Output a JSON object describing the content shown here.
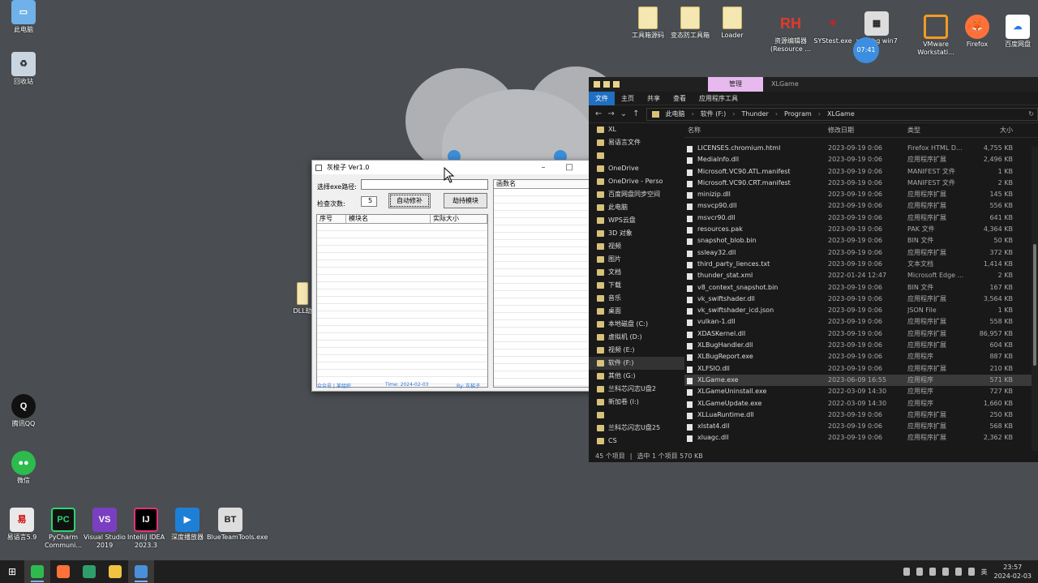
{
  "desktop": {
    "icons_left": [
      {
        "label": "此电脑",
        "name": "this-pc"
      },
      {
        "label": "回收站",
        "name": "recycle-bin"
      },
      {
        "label": "腾讯QQ",
        "name": "qq"
      },
      {
        "label": "微信",
        "name": "wechat"
      }
    ],
    "icons_bottom": [
      {
        "label": "易语言5.9",
        "name": "eyuyan"
      },
      {
        "label": "PyCharm Communi...",
        "name": "pycharm"
      },
      {
        "label": "Visual Studio 2019",
        "name": "visual-studio"
      },
      {
        "label": "IntelliJ IDEA 2023.3",
        "name": "intellij"
      },
      {
        "label": "深度播放器",
        "name": "player"
      },
      {
        "label": "BlueTeamTools.exe",
        "name": "blueteamtools"
      }
    ],
    "icons_top": [
      {
        "label": "工具箱源码",
        "name": "folder-toolbox-src"
      },
      {
        "label": "变态防工具箱",
        "name": "folder-toolbox"
      },
      {
        "label": "Loader",
        "name": "folder-loader"
      },
      {
        "label": "资源编辑器 (Resource ...",
        "name": "resource-hacker"
      },
      {
        "label": "SYStest.exe",
        "name": "systest"
      },
      {
        "label": "x64dbg win7",
        "name": "x64dbg"
      },
      {
        "label": "VMware Workstati...",
        "name": "vmware"
      },
      {
        "label": "Firefox",
        "name": "firefox"
      },
      {
        "label": "百度网盘",
        "name": "baidu-netdisk"
      }
    ],
    "partial_label": "DLL劫",
    "clock_badge": "07:41"
  },
  "app": {
    "title": "灰梭子 Ver1.0",
    "path_label": "选择exe路径:",
    "path_value": "",
    "check_label": "检查次数:",
    "check_value": "5",
    "auto_button": "自动修补",
    "hijack_button": "劫持模块",
    "left_columns": [
      "序号",
      "模块名",
      "实际大小"
    ],
    "right_columns": [
      "函数名"
    ],
    "footer": {
      "left": "众众号 | 某组织",
      "mid": "Time: 2024-02-03",
      "right": "By: 灰梭子"
    }
  },
  "explorer": {
    "manage_tab": "管理",
    "window_title": "XLGame",
    "ribbon_tabs": [
      "文件",
      "主页",
      "共享",
      "查看",
      "应用程序工具"
    ],
    "breadcrumbs": [
      "此电脑",
      "软件 (F:)",
      "Thunder",
      "Program",
      "XLGame"
    ],
    "columns": [
      "名称",
      "修改日期",
      "类型",
      "大小"
    ],
    "nav_items": [
      {
        "label": "XL",
        "selected": false
      },
      {
        "label": "易语言文件",
        "selected": false
      },
      {
        "label": "",
        "selected": false
      },
      {
        "label": "OneDrive",
        "selected": false
      },
      {
        "label": "OneDrive - Perso",
        "selected": false
      },
      {
        "label": "百度网盘同步空间",
        "selected": false
      },
      {
        "label": "此电脑",
        "selected": false
      },
      {
        "label": "WPS云盘",
        "selected": false
      },
      {
        "label": "3D 对象",
        "selected": false
      },
      {
        "label": "视频",
        "selected": false
      },
      {
        "label": "图片",
        "selected": false
      },
      {
        "label": "文档",
        "selected": false
      },
      {
        "label": "下载",
        "selected": false
      },
      {
        "label": "音乐",
        "selected": false
      },
      {
        "label": "桌面",
        "selected": false
      },
      {
        "label": "本地磁盘 (C:)",
        "selected": false
      },
      {
        "label": "虚拟机 (D:)",
        "selected": false
      },
      {
        "label": "视频 (E:)",
        "selected": false
      },
      {
        "label": "软件 (F:)",
        "selected": true
      },
      {
        "label": "其他 (G:)",
        "selected": false
      },
      {
        "label": "兰科芯闪志U盘2",
        "selected": false
      },
      {
        "label": "新加卷 (I:)",
        "selected": false
      },
      {
        "label": "",
        "selected": false
      },
      {
        "label": "兰科芯闪志U盘25",
        "selected": false
      },
      {
        "label": "CS",
        "selected": false
      }
    ],
    "files": [
      {
        "name": "LICENSES.chromium.html",
        "date": "2023-09-19 0:06",
        "type": "Firefox HTML D...",
        "size": "4,755 KB",
        "selected": false
      },
      {
        "name": "MediaInfo.dll",
        "date": "2023-09-19 0:06",
        "type": "应用程序扩展",
        "size": "2,496 KB",
        "selected": false
      },
      {
        "name": "Microsoft.VC90.ATL.manifest",
        "date": "2023-09-19 0:06",
        "type": "MANIFEST 文件",
        "size": "1 KB",
        "selected": false
      },
      {
        "name": "Microsoft.VC90.CRT.manifest",
        "date": "2023-09-19 0:06",
        "type": "MANIFEST 文件",
        "size": "2 KB",
        "selected": false
      },
      {
        "name": "minizip.dll",
        "date": "2023-09-19 0:06",
        "type": "应用程序扩展",
        "size": "145 KB",
        "selected": false
      },
      {
        "name": "msvcp90.dll",
        "date": "2023-09-19 0:06",
        "type": "应用程序扩展",
        "size": "556 KB",
        "selected": false
      },
      {
        "name": "msvcr90.dll",
        "date": "2023-09-19 0:06",
        "type": "应用程序扩展",
        "size": "641 KB",
        "selected": false
      },
      {
        "name": "resources.pak",
        "date": "2023-09-19 0:06",
        "type": "PAK 文件",
        "size": "4,364 KB",
        "selected": false
      },
      {
        "name": "snapshot_blob.bin",
        "date": "2023-09-19 0:06",
        "type": "BIN 文件",
        "size": "50 KB",
        "selected": false
      },
      {
        "name": "ssleay32.dll",
        "date": "2023-09-19 0:06",
        "type": "应用程序扩展",
        "size": "372 KB",
        "selected": false
      },
      {
        "name": "third_party_liences.txt",
        "date": "2023-09-19 0:06",
        "type": "文本文档",
        "size": "1,414 KB",
        "selected": false
      },
      {
        "name": "thunder_stat.xml",
        "date": "2022-01-24 12:47",
        "type": "Microsoft Edge ...",
        "size": "2 KB",
        "selected": false
      },
      {
        "name": "v8_context_snapshot.bin",
        "date": "2023-09-19 0:06",
        "type": "BIN 文件",
        "size": "167 KB",
        "selected": false
      },
      {
        "name": "vk_swiftshader.dll",
        "date": "2023-09-19 0:06",
        "type": "应用程序扩展",
        "size": "3,564 KB",
        "selected": false
      },
      {
        "name": "vk_swiftshader_icd.json",
        "date": "2023-09-19 0:06",
        "type": "JSON File",
        "size": "1 KB",
        "selected": false
      },
      {
        "name": "vulkan-1.dll",
        "date": "2023-09-19 0:06",
        "type": "应用程序扩展",
        "size": "558 KB",
        "selected": false
      },
      {
        "name": "XDASKernel.dll",
        "date": "2023-09-19 0:06",
        "type": "应用程序扩展",
        "size": "86,957 KB",
        "selected": false
      },
      {
        "name": "XLBugHandler.dll",
        "date": "2023-09-19 0:06",
        "type": "应用程序扩展",
        "size": "604 KB",
        "selected": false
      },
      {
        "name": "XLBugReport.exe",
        "date": "2023-09-19 0:06",
        "type": "应用程序",
        "size": "887 KB",
        "selected": false
      },
      {
        "name": "XLFSIO.dll",
        "date": "2023-09-19 0:06",
        "type": "应用程序扩展",
        "size": "210 KB",
        "selected": false
      },
      {
        "name": "XLGame.exe",
        "date": "2023-06-09 16:55",
        "type": "应用程序",
        "size": "571 KB",
        "selected": true
      },
      {
        "name": "XLGameUninstall.exe",
        "date": "2022-03-09 14:30",
        "type": "应用程序",
        "size": "727 KB",
        "selected": false
      },
      {
        "name": "XLGameUpdate.exe",
        "date": "2022-03-09 14:30",
        "type": "应用程序",
        "size": "1,660 KB",
        "selected": false
      },
      {
        "name": "XLLuaRuntime.dll",
        "date": "2023-09-19 0:06",
        "type": "应用程序扩展",
        "size": "250 KB",
        "selected": false
      },
      {
        "name": "xlstat4.dll",
        "date": "2023-09-19 0:06",
        "type": "应用程序扩展",
        "size": "568 KB",
        "selected": false
      },
      {
        "name": "xluagc.dll",
        "date": "2023-09-19 0:06",
        "type": "应用程序扩展",
        "size": "2,362 KB",
        "selected": false
      }
    ],
    "status": {
      "count": "45 个项目",
      "selection": "选中 1 个项目  570 KB"
    }
  },
  "taskbar": {
    "apps": [
      {
        "name": "wechat",
        "color": "#2dbb4e",
        "active": true
      },
      {
        "name": "firefox",
        "color": "#ff7139",
        "active": false
      },
      {
        "name": "terminal",
        "color": "#2e9e6a",
        "active": false
      },
      {
        "name": "file-explorer",
        "color": "#f0c341",
        "active": false
      },
      {
        "name": "app-window",
        "color": "#4a90d9",
        "active": true
      }
    ],
    "ime": "英",
    "time": "23:57",
    "date": "2024-02-03"
  }
}
